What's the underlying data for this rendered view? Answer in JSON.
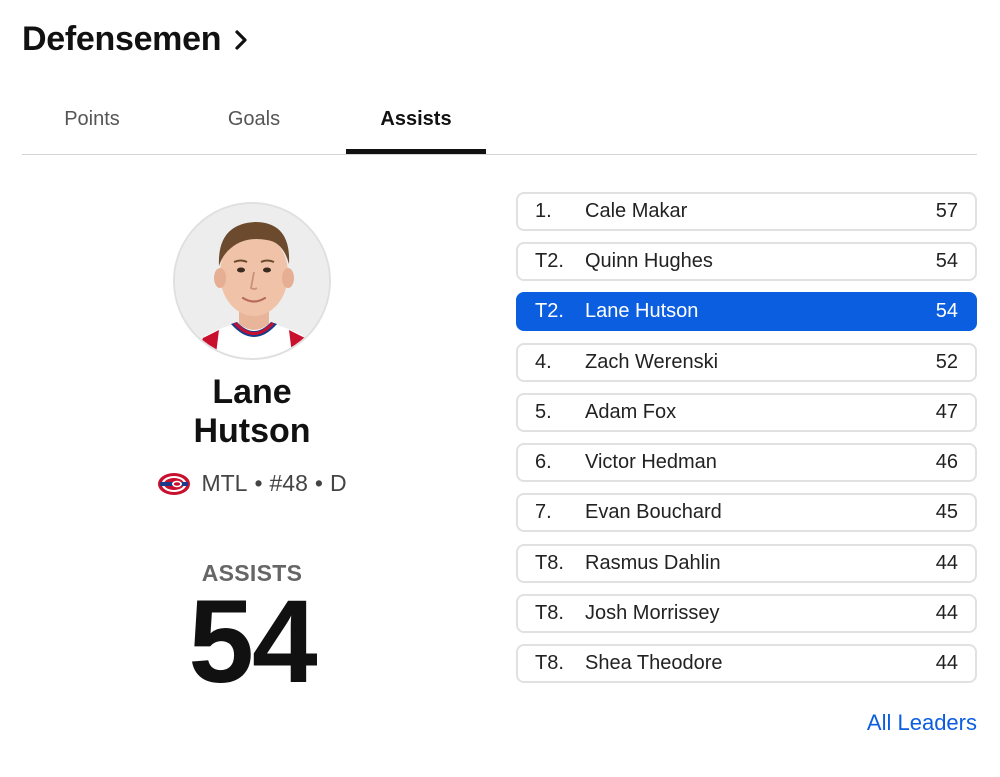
{
  "header": {
    "title": "Defensemen"
  },
  "tabs": [
    {
      "label": "Points"
    },
    {
      "label": "Goals"
    },
    {
      "label": "Assists"
    }
  ],
  "active_tab": "Assists",
  "featured": {
    "first_name": "Lane",
    "last_name": "Hutson",
    "team": "MTL",
    "sep1": "•",
    "number": "#48",
    "sep2": "•",
    "position": "D",
    "stat_label": "ASSISTS",
    "stat_value": "54"
  },
  "leaders": [
    {
      "rank": "1.",
      "name": "Cale Makar",
      "value": "57"
    },
    {
      "rank": "T2.",
      "name": "Quinn Hughes",
      "value": "54"
    },
    {
      "rank": "T2.",
      "name": "Lane Hutson",
      "value": "54"
    },
    {
      "rank": "4.",
      "name": "Zach Werenski",
      "value": "52"
    },
    {
      "rank": "5.",
      "name": "Adam Fox",
      "value": "47"
    },
    {
      "rank": "6.",
      "name": "Victor Hedman",
      "value": "46"
    },
    {
      "rank": "7.",
      "name": "Evan Bouchard",
      "value": "45"
    },
    {
      "rank": "T8.",
      "name": "Rasmus Dahlin",
      "value": "44"
    },
    {
      "rank": "T8.",
      "name": "Josh Morrissey",
      "value": "44"
    },
    {
      "rank": "T8.",
      "name": "Shea Theodore",
      "value": "44"
    }
  ],
  "highlight_index": 2,
  "all_leaders_link": "All Leaders",
  "colors": {
    "accent": "#0b5ee0",
    "text": "#111111",
    "border": "#e1e1e1"
  },
  "icons": {
    "header_arrow": "chevron-right-icon",
    "team_logo": "canadiens-logo-icon"
  }
}
